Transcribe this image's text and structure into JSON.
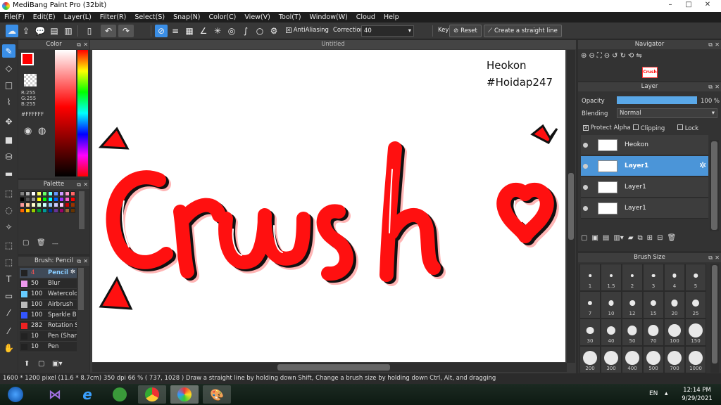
{
  "window": {
    "title": "MediBang Paint Pro (32bit)",
    "controls": [
      "–",
      "□",
      "✕"
    ]
  },
  "menu": [
    "File(F)",
    "Edit(E)",
    "Layer(L)",
    "Filter(R)",
    "Select(S)",
    "Snap(N)",
    "Color(C)",
    "View(V)",
    "Tool(T)",
    "Window(W)",
    "Cloud",
    "Help"
  ],
  "toolbar": {
    "antialiasing_label": "AntiAliasing",
    "antialiasing_checked": true,
    "correction_label": "Correction",
    "correction_value": "40",
    "key_label": "Key",
    "reset_label": "Reset",
    "straight_line_label": "Create a straight line"
  },
  "color_panel": {
    "title": "Color",
    "r": "R:255",
    "g": "G:255",
    "b": "B:255",
    "hex": "#FFFFFF",
    "foreground": "#ff0000",
    "background": "#ffffff"
  },
  "palette_panel": {
    "title": "Palette",
    "more": "---",
    "colors": [
      "#7f7f7f",
      "#b5b5b5",
      "#ffffff",
      "#ffff66",
      "#66ff66",
      "#66ffff",
      "#6699ff",
      "#cc99ff",
      "#ff99cc",
      "#ff6666",
      "#000000",
      "#555555",
      "#999999",
      "#ffff00",
      "#00ff00",
      "#00ffff",
      "#0066ff",
      "#9933ff",
      "#ff66cc",
      "#ff0000",
      "#ff9999",
      "#ffcc99",
      "#ffffcc",
      "#ccffcc",
      "#ccffff",
      "#99ccff",
      "#ccccff",
      "#ffccff",
      "#cc0000",
      "#993300",
      "#ff6600",
      "#ffcc00",
      "#99cc00",
      "#009933",
      "#009999",
      "#003399",
      "#663399",
      "#990066",
      "#996633",
      "#663300"
    ]
  },
  "brush_panel": {
    "title": "Brush: Pencil",
    "items": [
      {
        "color": "#222222",
        "value": "4",
        "name": "Pencil",
        "selected": true
      },
      {
        "color": "#ee99ee",
        "value": "50",
        "name": "Blur"
      },
      {
        "color": "#66ccff",
        "value": "100",
        "name": "Watercolor"
      },
      {
        "color": "#bbbbbb",
        "value": "100",
        "name": "Airbrush"
      },
      {
        "color": "#3355ff",
        "value": "100",
        "name": "Sparkle Brush"
      },
      {
        "color": "#ee2222",
        "value": "282",
        "name": "Rotation S"
      },
      {
        "color": "#222222",
        "value": "10",
        "name": "Pen (Shar"
      },
      {
        "color": "#222222",
        "value": "10",
        "name": "Pen"
      }
    ]
  },
  "canvas": {
    "title": "Untitled",
    "signature_name": "Heokon",
    "signature_tag": "#Hoidap247",
    "artwork_word": "Crush"
  },
  "navigator": {
    "title": "Navigator",
    "thumbnail_text": "Crush"
  },
  "layer_panel": {
    "title": "Layer",
    "opacity_label": "Opacity",
    "opacity_value": "100 %",
    "opacity_fraction": 1.0,
    "blending_label": "Blending",
    "blending_value": "Normal",
    "protect_alpha_label": "Protect Alpha",
    "protect_alpha_checked": true,
    "clipping_label": "Clipping",
    "lock_label": "Lock",
    "layers": [
      {
        "name": "Heokon",
        "selected": false
      },
      {
        "name": "Layer1",
        "selected": true
      },
      {
        "name": "Layer1",
        "selected": false
      },
      {
        "name": "Layer1",
        "selected": false
      }
    ]
  },
  "brush_size_panel": {
    "title": "Brush Size",
    "sizes": [
      "1",
      "1.5",
      "2",
      "3",
      "4",
      "5",
      "7",
      "10",
      "12",
      "15",
      "20",
      "25",
      "30",
      "40",
      "50",
      "70",
      "100",
      "150",
      "200",
      "300",
      "400",
      "500",
      "700",
      "1000"
    ]
  },
  "status_bar": {
    "text": "1600 * 1200 pixel   (11.6 * 8.7cm)   350 dpi   66 %   ( 737, 1028 )   Draw a straight line by holding down Shift, Change a brush size by holding down Ctrl, Alt, and dragging"
  },
  "taskbar": {
    "lang": "EN",
    "time": "12:14 PM",
    "date": "9/29/2021"
  }
}
